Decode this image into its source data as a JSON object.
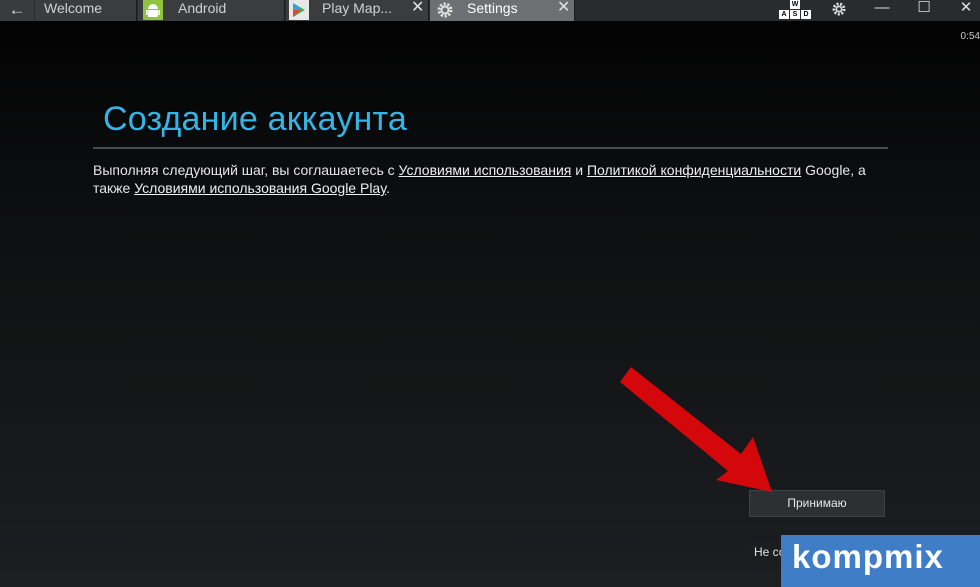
{
  "topbar": {
    "back_icon": "arrow-left-icon",
    "tabs": [
      {
        "label": "Welcome",
        "icon": "",
        "closable": false,
        "active": false
      },
      {
        "label": "Android",
        "icon": "android-icon",
        "closable": false,
        "active": false
      },
      {
        "label": "Play  Map...",
        "icon": "play-store-icon",
        "closable": true,
        "active": false
      },
      {
        "label": "Settings",
        "icon": "gear-icon",
        "closable": true,
        "active": true
      }
    ],
    "keyboard_keys": [
      "W",
      "A",
      "S",
      "D"
    ],
    "window_controls": [
      "gear-icon",
      "minimize-icon",
      "maximize-icon",
      "close-icon"
    ]
  },
  "screen": {
    "clock": "0:54",
    "title": "Создание аккаунта",
    "terms": {
      "part1": "Выполняя следующий шаг, вы соглашаетесь с ",
      "link1": "Условиями использования",
      "part2": " и ",
      "link2": "Политикой конфиденциальности",
      "part3": " Google, а также ",
      "link3": "Условиями использования Google Play",
      "part4": "."
    },
    "accept_button": "Принимаю",
    "decline_button": "Не согласен"
  },
  "overlay": {
    "arrow_color": "#d4070b",
    "logo_text": "kompmix",
    "logo_color": "#3f7ec7"
  }
}
